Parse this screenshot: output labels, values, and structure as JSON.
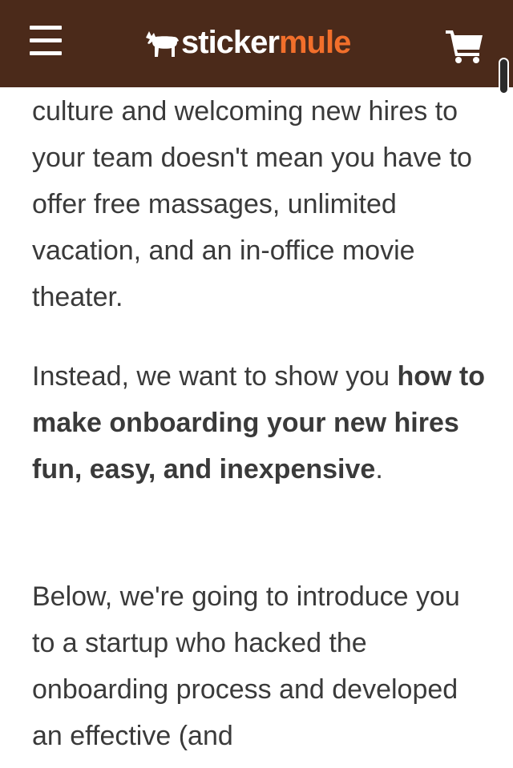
{
  "header": {
    "menu_icon": "hamburger-menu-icon",
    "logo_text_white": "sticker",
    "logo_text_orange": "mule",
    "cart_icon": "shopping-cart-icon",
    "brand_bg": "#4b2a1a",
    "brand_orange": "#f26f2b"
  },
  "article": {
    "p1": "culture and welcoming new hires to your team doesn't mean you have to offer free massages, unlimited vacation, and an in-office movie theater.",
    "p2_intro": "Instead, we want to show you ",
    "p2_bold": "how to make onboarding your new hires fun, easy, and inexpensive",
    "p2_end": ".",
    "p3": "Below, we're going to introduce you to a startup who hacked the onboarding process and developed an effective (and"
  }
}
